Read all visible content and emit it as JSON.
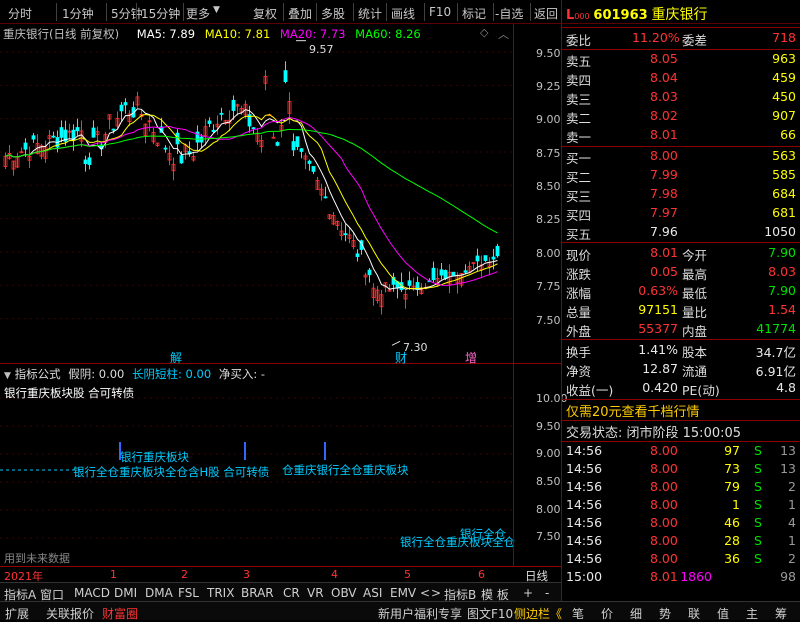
{
  "toolbar": {
    "left": [
      "分时",
      "1分钟",
      "5分钟",
      "15分钟",
      "更多"
    ],
    "right": [
      "复权",
      "叠加",
      "多股",
      "统计",
      "画线",
      "F10",
      "标记",
      "-自选",
      "返回"
    ]
  },
  "chart": {
    "name": "重庆银行(日线 前复权)",
    "ma5": "MA5: 7.89",
    "ma10": "MA10: 7.81",
    "ma20": "MA20: 7.73",
    "ma60": "MA60: 8.26",
    "high_label": "9.57",
    "low_label": "7.30",
    "marks": [
      "解",
      "财",
      "增"
    ],
    "y_ticks": [
      "9.50",
      "9.25",
      "9.00",
      "8.75",
      "8.50",
      "8.25",
      "8.00",
      "7.75",
      "7.50"
    ]
  },
  "indicator": {
    "header": "指标公式  假阴: 0.00  长阴短柱: 0.00  净买入: -",
    "header_parts": [
      "指标公式",
      "假阴: 0.00",
      "长阴短柱: 0.00",
      "净买入: -"
    ],
    "subtitle": "银行重庆板块股 合可转债",
    "future_note": "用到未来数据",
    "y_ticks": [
      "10.00",
      "9.50",
      "9.00",
      "8.50",
      "8.00",
      "7.50"
    ],
    "texts": [
      "银行重庆板块",
      "银行全仓重庆板块全仓含H股 合可转债",
      "仓重庆银行全仓重庆板块",
      "银行全仓重庆板块全仓",
      "银行全仓"
    ]
  },
  "timeline": {
    "year": "2021年",
    "months": [
      "1",
      "2",
      "3",
      "4",
      "5",
      "6"
    ],
    "period": "日线"
  },
  "bottom_tabs": {
    "row1": [
      "指标A",
      "窗口",
      "MACD",
      "DMI",
      "DMA",
      "FSL",
      "TRIX",
      "BRAR",
      "CR",
      "VR",
      "OBV",
      "ASI",
      "EMV",
      "<",
      ">",
      "指标B",
      "模 板",
      "+",
      "-"
    ],
    "row2": [
      "扩展",
      "关联报价",
      "财富圈"
    ],
    "row2_right": [
      "新用户福利专享",
      "图文F10",
      "侧边栏《"
    ]
  },
  "stock": {
    "prefix": "L",
    "code": "601963",
    "name": "重庆银行",
    "level": "000"
  },
  "order_book": {
    "wb_label": "委比",
    "wb": "11.20%",
    "wc_label": "委差",
    "wc": "718",
    "asks": [
      {
        "l": "卖五",
        "p": "8.05",
        "v": "963"
      },
      {
        "l": "卖四",
        "p": "8.04",
        "v": "459"
      },
      {
        "l": "卖三",
        "p": "8.03",
        "v": "450"
      },
      {
        "l": "卖二",
        "p": "8.02",
        "v": "907"
      },
      {
        "l": "卖一",
        "p": "8.01",
        "v": "66"
      }
    ],
    "bids": [
      {
        "l": "买一",
        "p": "8.00",
        "v": "563"
      },
      {
        "l": "买二",
        "p": "7.99",
        "v": "585"
      },
      {
        "l": "买三",
        "p": "7.98",
        "v": "684"
      },
      {
        "l": "买四",
        "p": "7.97",
        "v": "681"
      },
      {
        "l": "买五",
        "p": "7.96",
        "v": "1050"
      }
    ]
  },
  "quote": [
    {
      "l1": "现价",
      "v1": "8.01",
      "c1": "red",
      "l2": "今开",
      "v2": "7.90",
      "c2": "grn"
    },
    {
      "l1": "涨跌",
      "v1": "0.05",
      "c1": "red",
      "l2": "最高",
      "v2": "8.03",
      "c2": "red"
    },
    {
      "l1": "涨幅",
      "v1": "0.63%",
      "c1": "red",
      "l2": "最低",
      "v2": "7.90",
      "c2": "grn"
    },
    {
      "l1": "总量",
      "v1": "97151",
      "c1": "yel",
      "l2": "量比",
      "v2": "1.54",
      "c2": "red"
    },
    {
      "l1": "外盘",
      "v1": "55377",
      "c1": "red",
      "l2": "内盘",
      "v2": "41774",
      "c2": "grn"
    }
  ],
  "stats": [
    {
      "l1": "换手",
      "v1": "1.41%",
      "l2": "股本",
      "v2": "34.7亿"
    },
    {
      "l1": "净资",
      "v1": "12.87",
      "l2": "流通",
      "v2": "6.91亿"
    },
    {
      "l1": "收益(一)",
      "v1": "0.420",
      "l2": "PE(动)",
      "v2": "4.8"
    }
  ],
  "promo": "仅需20元查看千档行情",
  "trade_status": "交易状态: 闭市阶段  15:00:05",
  "ticks": [
    {
      "t": "14:56",
      "p": "8.00",
      "v": "97",
      "s": "S",
      "n": "13"
    },
    {
      "t": "14:56",
      "p": "8.00",
      "v": "73",
      "s": "S",
      "n": "13"
    },
    {
      "t": "14:56",
      "p": "8.00",
      "v": "79",
      "s": "S",
      "n": "2"
    },
    {
      "t": "14:56",
      "p": "8.00",
      "v": "1",
      "s": "S",
      "n": "1"
    },
    {
      "t": "14:56",
      "p": "8.00",
      "v": "46",
      "s": "S",
      "n": "4"
    },
    {
      "t": "14:56",
      "p": "8.00",
      "v": "28",
      "s": "S",
      "n": "1"
    },
    {
      "t": "14:56",
      "p": "8.00",
      "v": "36",
      "s": "S",
      "n": "2"
    },
    {
      "t": "15:00",
      "p": "8.01",
      "v": "1860",
      "s": "",
      "n": "98"
    }
  ],
  "right_tabs": [
    "笔",
    "价",
    "细",
    "势",
    "联",
    "值",
    "主",
    "筹"
  ],
  "colors": {
    "up": "#ff3333",
    "down": "#00e000",
    "ma5": "#ffffff",
    "ma10": "#ffff00",
    "ma20": "#ff00ff",
    "ma60": "#00ff00",
    "candle_down": "#00ffff"
  }
}
